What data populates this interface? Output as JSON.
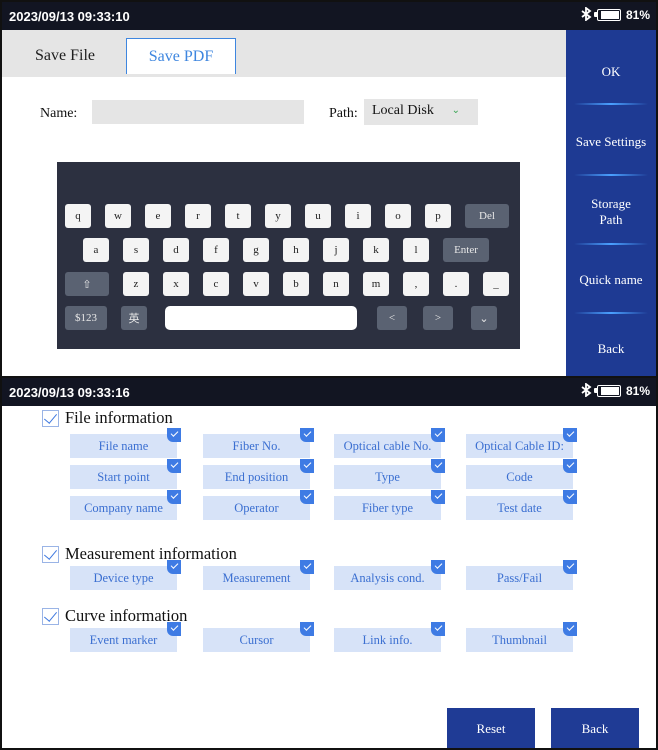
{
  "screen1": {
    "status": {
      "time": "2023/09/13 09:33:10",
      "battery": "81%",
      "battery_level": 0.81
    },
    "tabs": [
      {
        "label": "Save File"
      },
      {
        "label": "Save PDF"
      }
    ],
    "form": {
      "name_label": "Name:",
      "name_value": "",
      "path_label": "Path:",
      "path_value": "Local Disk"
    },
    "keyboard": {
      "row1": [
        "q",
        "w",
        "e",
        "r",
        "t",
        "y",
        "u",
        "i",
        "o",
        "p",
        "Del"
      ],
      "row2": [
        "a",
        "s",
        "d",
        "f",
        "g",
        "h",
        "j",
        "k",
        "l",
        "Enter"
      ],
      "row3": [
        "⇧",
        "z",
        "x",
        "c",
        "v",
        "b",
        "n",
        "m",
        ",",
        ".",
        "_"
      ],
      "row4": [
        "$123",
        "英",
        "",
        "<",
        ">",
        "⌄"
      ]
    },
    "sidebar": [
      {
        "label": "OK"
      },
      {
        "label": "Save Settings"
      },
      {
        "label": "Storage Path"
      },
      {
        "label": "Quick name"
      },
      {
        "label": "Back"
      }
    ]
  },
  "screen2": {
    "status": {
      "time": "2023/09/13 09:33:16",
      "battery": "81%",
      "battery_level": 0.81
    },
    "sections": [
      {
        "title": "File information",
        "checked": true,
        "options": [
          "File name",
          "Fiber No.",
          "Optical cable No.",
          "Optical Cable ID:",
          "Start point",
          "End position",
          "Type",
          "Code",
          "Company name",
          "Operator",
          "Fiber type",
          "Test date"
        ]
      },
      {
        "title": "Measurement information",
        "checked": true,
        "options": [
          "Device type",
          "Measurement",
          "Analysis cond.",
          "Pass/Fail"
        ]
      },
      {
        "title": "Curve information",
        "checked": true,
        "options": [
          "Event marker",
          "Cursor",
          "Link info.",
          "Thumbnail"
        ]
      }
    ],
    "buttons": {
      "reset": "Reset",
      "back": "Back"
    }
  },
  "colors": {
    "statusbar": "#121522",
    "sidebar": "#1e3a93",
    "accent": "#3e7be4",
    "option_bg": "#d7e3f8",
    "keyboard_bg": "#2c3040"
  }
}
